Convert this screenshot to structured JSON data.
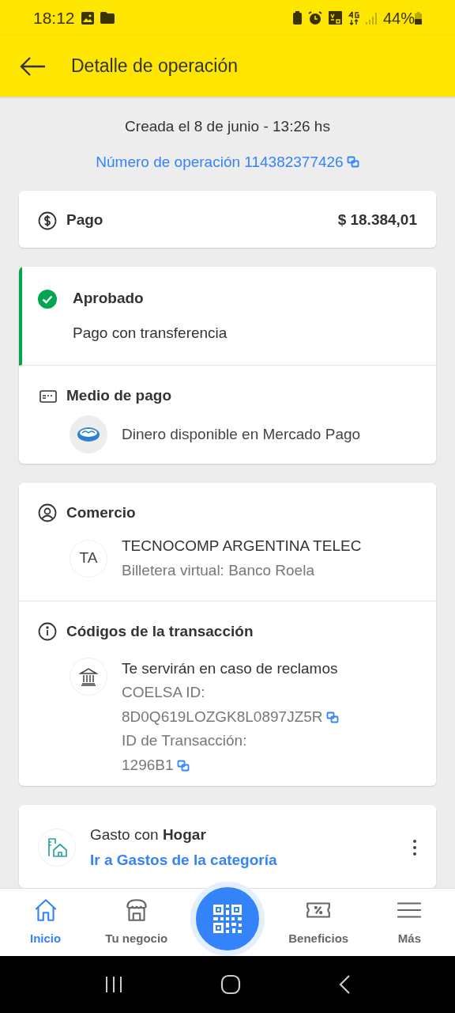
{
  "status_bar": {
    "time": "18:12",
    "battery": "44%"
  },
  "header": {
    "title": "Detalle de operación"
  },
  "created": "Creada el 8 de junio - 13:26 hs",
  "operation_number": "Número de operación 114382377426",
  "payment": {
    "label": "Pago",
    "amount": "$ 18.384,01"
  },
  "status": {
    "kind": "approved",
    "title": "Aprobado",
    "subtitle": "Pago con transferencia"
  },
  "payment_method": {
    "title": "Medio de pago",
    "value": "Dinero disponible en Mercado Pago"
  },
  "merchant": {
    "title": "Comercio",
    "initials": "TA",
    "name": "TECNOCOMP ARGENTINA TELEC",
    "detail": "Billetera virtual: Banco Roela"
  },
  "transaction_codes": {
    "title": "Códigos de la transacción",
    "note": "Te servirán en caso de reclamos",
    "lines": [
      {
        "text": "COELSA ID:",
        "copyable": false
      },
      {
        "text": "8D0Q619LOZGK8L0897JZ5R",
        "copyable": true
      },
      {
        "text": "ID de Transacción:",
        "copyable": false
      },
      {
        "text": "1296B1",
        "copyable": true
      }
    ]
  },
  "category": {
    "text": "Gasto con **Hogar**",
    "link": "Ir a Gastos de la categoría"
  },
  "nav": [
    {
      "kind": "home",
      "label": "Inicio",
      "selected": true
    },
    {
      "kind": "store",
      "label": "Tu negocio",
      "selected": false
    },
    {
      "kind": "qr",
      "selected": false
    },
    {
      "kind": "benefits",
      "label": "Beneficios",
      "selected": false
    },
    {
      "kind": "menu",
      "label": "Más",
      "selected": false
    }
  ]
}
